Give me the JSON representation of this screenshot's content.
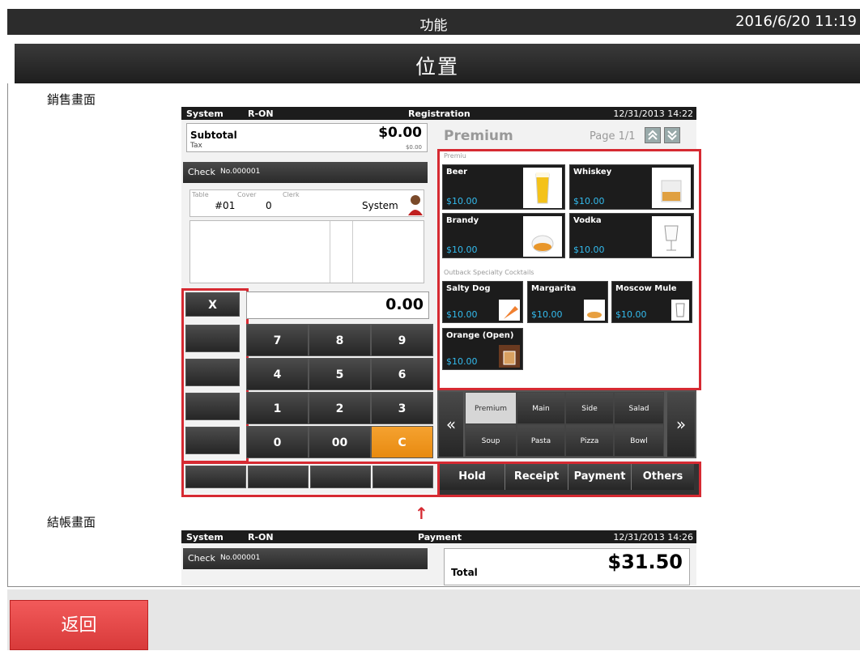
{
  "top_bar": {
    "title": "功能",
    "clock": "2016/6/20 11:19"
  },
  "page_title": "位置",
  "sections": {
    "sales": "銷售畫面",
    "checkout": "結帳畫面"
  },
  "back_button": "返回",
  "sales_screen": {
    "header": {
      "user": "System",
      "mode": "R-ON",
      "screen": "Registration",
      "datetime": "12/31/2013 14:22"
    },
    "subtotal_label": "Subtotal",
    "subtotal_value": "$0.00",
    "tax_label": "Tax",
    "tax_value": "$0.00",
    "check_label": "Check",
    "check_no": "No.000001",
    "table_label": "Table",
    "table_value": "#01",
    "cover_label": "Cover",
    "cover_value": "0",
    "clerk_label": "Clerk",
    "clerk_value": "System",
    "entry_value": "0.00",
    "x_key": "X",
    "keypad": [
      "7",
      "8",
      "9",
      "4",
      "5",
      "6",
      "1",
      "2",
      "3",
      "0",
      "00",
      "C"
    ],
    "menu_title": "Premium",
    "page_label": "Page 1/1",
    "group1": "Premiu",
    "group2": "Outback Specialty Cocktails",
    "items": [
      {
        "name": "Beer",
        "price": "$10.00"
      },
      {
        "name": "Whiskey",
        "price": "$10.00"
      },
      {
        "name": "Brandy",
        "price": "$10.00"
      },
      {
        "name": "Vodka",
        "price": "$10.00"
      },
      {
        "name": "Salty Dog",
        "price": "$10.00"
      },
      {
        "name": "Margarita",
        "price": "$10.00"
      },
      {
        "name": "Moscow Mule",
        "price": "$10.00"
      },
      {
        "name": "Orange (Open)",
        "price": "$10.00"
      }
    ],
    "categories": [
      "Premium",
      "Main",
      "Side",
      "Salad",
      "Soup",
      "Pasta",
      "Pizza",
      "Bowl"
    ],
    "prev_arrow": "«",
    "next_arrow": "»",
    "actions": [
      "Hold",
      "Receipt",
      "Payment",
      "Others"
    ]
  },
  "checkout_screen": {
    "header": {
      "user": "System",
      "mode": "R-ON",
      "screen": "Payment",
      "datetime": "12/31/2013 14:26"
    },
    "check_label": "Check",
    "check_no": "No.000001",
    "total_label": "Total",
    "total_value": "$31.50"
  },
  "arrow": "↑",
  "colors": {
    "highlight": "#d62a32",
    "price": "#33bbee",
    "clear_key": "#f0951c",
    "back_button": "#e84848"
  }
}
